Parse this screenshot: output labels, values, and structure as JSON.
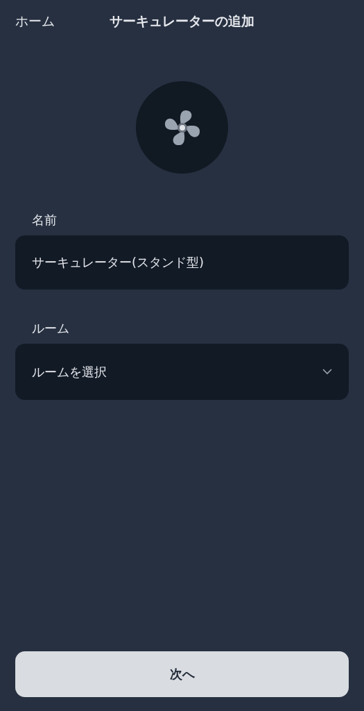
{
  "header": {
    "back": "ホーム",
    "title": "サーキュレーターの追加"
  },
  "fields": [
    {
      "kind": "text",
      "label": "名前",
      "value": "サーキュレーター(スタンド型)"
    },
    {
      "kind": "select",
      "label": "ルーム",
      "placeholder": "ルームを選択"
    }
  ],
  "primary_button": "次へ"
}
